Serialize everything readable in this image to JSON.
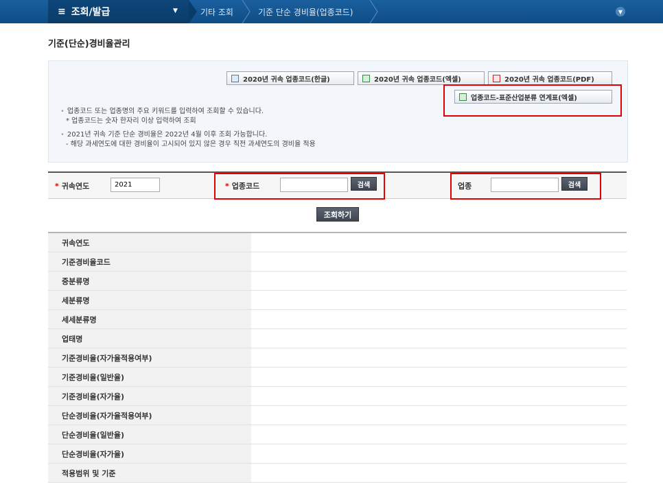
{
  "topbar": {
    "menu_title": "조회/발급",
    "breadcrumbs": [
      "기타 조회",
      "기준 단순 경비율(업종코드)"
    ]
  },
  "page": {
    "title": "기준(단순)경비율관리"
  },
  "downloads": {
    "hwp": "2020년 귀속 업종코드(한글)",
    "xls": "2020년 귀속 업종코드(엑셀)",
    "pdf": "2020년 귀속 업종코드(PDF)",
    "mapping_xls": "업종코드-표준산업분류 연계표(엑셀)"
  },
  "notes": [
    "업종코드 또는 업종명의 주요 키워드를 입력하여 조회할 수 있습니다.",
    "* 업종코드는 숫자 한자리 이상 입력하여 조회",
    "2021년 귀속 기준 단순 경비율은 2022년 4월 이후 조회 가능합니다.",
    "- 해당 과세연도에 대한 경비율이 고시되어 있지 않은 경우 직전 과세연도의 경비율 적용"
  ],
  "search": {
    "year_label": "귀속연도",
    "year_value": "2021",
    "code_label": "업종코드",
    "code_value": "",
    "industry_label": "업종",
    "industry_value": "",
    "search_button": "검색",
    "query_button": "조회하기"
  },
  "result_rows": [
    "귀속연도",
    "기준경비율코드",
    "중분류명",
    "세분류명",
    "세세분류명",
    "업태명",
    "기준경비율(자가율적용여부)",
    "기준경비율(일반율)",
    "기준경비율(자가율)",
    "단순경비율(자가율적용여부)",
    "단순경비율(일반율)",
    "단순경비율(자가율)",
    "적용범위 및 기준"
  ],
  "colors": {
    "topbar": "#0f4d86",
    "highlight": "#e30000",
    "required": "#d40000"
  }
}
